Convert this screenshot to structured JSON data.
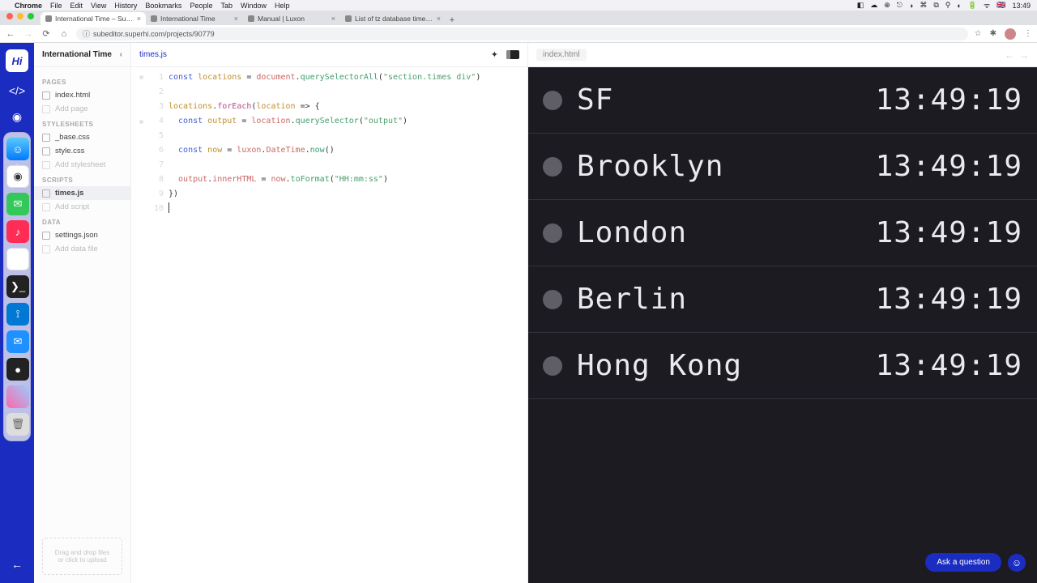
{
  "menubar": {
    "apple": "",
    "app": "Chrome",
    "items": [
      "File",
      "Edit",
      "View",
      "History",
      "Bookmarks",
      "People",
      "Tab",
      "Window",
      "Help"
    ],
    "clock": "13:49",
    "flag": "🇬🇧"
  },
  "browser": {
    "tabs": [
      {
        "title": "International Time – SuperHi",
        "active": true
      },
      {
        "title": "International Time",
        "active": false
      },
      {
        "title": "Manual | Luxon",
        "active": false
      },
      {
        "title": "List of tz database time zones",
        "active": false
      }
    ],
    "url": "subeditor.superhi.com/projects/90779"
  },
  "rail": {
    "logo": "Hi"
  },
  "sidebar": {
    "project": "International Time",
    "groups": [
      {
        "label": "PAGES",
        "items": [
          {
            "name": "index.html",
            "add": false
          },
          {
            "name": "Add page",
            "add": true
          }
        ]
      },
      {
        "label": "STYLESHEETS",
        "items": [
          {
            "name": "_base.css",
            "add": false
          },
          {
            "name": "style.css",
            "add": false
          },
          {
            "name": "Add stylesheet",
            "add": true
          }
        ]
      },
      {
        "label": "SCRIPTS",
        "items": [
          {
            "name": "times.js",
            "add": false,
            "active": true
          },
          {
            "name": "Add script",
            "add": true
          }
        ]
      },
      {
        "label": "DATA",
        "items": [
          {
            "name": "settings.json",
            "add": false
          },
          {
            "name": "Add data file",
            "add": true
          }
        ]
      }
    ],
    "dropzone_line1": "Drag and drop files",
    "dropzone_line2": "or click to upload"
  },
  "editor": {
    "tab": "times.js",
    "lines": [
      1,
      2,
      3,
      4,
      5,
      6,
      7,
      8,
      9,
      10
    ],
    "code": {
      "l1_const": "const ",
      "l1_var": "locations",
      "l1_eq": " = ",
      "l1_doc": "document",
      "l1_dot1": ".",
      "l1_meth": "querySelectorAll",
      "l1_open": "(",
      "l1_str": "\"section.times div\"",
      "l1_close": ")",
      "l3_var": "locations",
      "l3_dot": ".",
      "l3_each": "forEach",
      "l3_open": "(",
      "l3_param": "location",
      "l3_arrow": " => {",
      "l4_const": "  const ",
      "l4_var": "output",
      "l4_eq": " = ",
      "l4_loc": "location",
      "l4_dot": ".",
      "l4_meth": "querySelector",
      "l4_open": "(",
      "l4_str": "\"output\"",
      "l4_close": ")",
      "l6_const": "  const ",
      "l6_var": "now",
      "l6_eq": " = ",
      "l6_lux": "luxon",
      "l6_dot1": ".",
      "l6_dt": "DateTime",
      "l6_dot2": ".",
      "l6_now": "now",
      "l6_par": "()",
      "l8_out": "  output",
      "l8_dot": ".",
      "l8_ih": "innerHTML",
      "l8_eq": " = ",
      "l8_now": "now",
      "l8_dot2": ".",
      "l8_tf": "toFormat",
      "l8_open": "(",
      "l8_str": "\"HH:mm:ss\"",
      "l8_close": ")",
      "l9": "})"
    }
  },
  "preview": {
    "tab": "index.html",
    "cities": [
      {
        "name": "SF",
        "time": "13:49:19"
      },
      {
        "name": "Brooklyn",
        "time": "13:49:19"
      },
      {
        "name": "London",
        "time": "13:49:19"
      },
      {
        "name": "Berlin",
        "time": "13:49:19"
      },
      {
        "name": "Hong Kong",
        "time": "13:49:19"
      }
    ]
  },
  "help": {
    "label": "Ask a question"
  }
}
